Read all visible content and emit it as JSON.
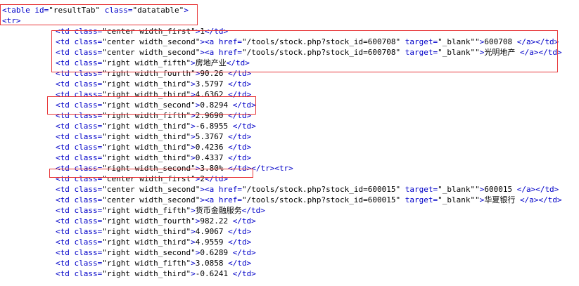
{
  "code_view": {
    "lines": [
      {
        "kind": "open_table",
        "tag": "table",
        "attr1": "id",
        "val1": "\"resultTab\"",
        "attr2": "class",
        "val2": "\"datatable\""
      },
      {
        "kind": "open_tr",
        "tag": "tr"
      },
      {
        "kind": "td",
        "cls": "\"center width_first\"",
        "text": "1"
      },
      {
        "kind": "td_link",
        "cls": "\"center width_second\"",
        "href": "\"/tools/stock.php?stock_id=600708\"",
        "target": "\"_blank\"\"",
        "text": "600708 "
      },
      {
        "kind": "td_link",
        "cls": "\"center width_second\"",
        "href": "\"/tools/stock.php?stock_id=600708\"",
        "target": "\"_blank\"\"",
        "text": "光明地产 "
      },
      {
        "kind": "td",
        "cls": "\"right width_fifth\"",
        "text": "房地产业"
      },
      {
        "kind": "td",
        "cls": "\"right width_fourth\"",
        "text": "90.26 "
      },
      {
        "kind": "td",
        "cls": "\"right width_third\"",
        "text": "3.5797 "
      },
      {
        "kind": "td",
        "cls": "\"right width_third\"",
        "text": "4.6362 "
      },
      {
        "kind": "td",
        "cls": "\"right width_second\"",
        "text": "0.8294 "
      },
      {
        "kind": "td",
        "cls": "\"right width_fifth\"",
        "text": "2.9690 "
      },
      {
        "kind": "td",
        "cls": "\"right width_third\"",
        "text": "-6.8955 "
      },
      {
        "kind": "td",
        "cls": "\"right width_third\"",
        "text": "5.3767 "
      },
      {
        "kind": "td",
        "cls": "\"right width_third\"",
        "text": "0.4236 "
      },
      {
        "kind": "td",
        "cls": "\"right width_third\"",
        "text": "0.4337 "
      },
      {
        "kind": "td_close_row",
        "cls": "\"right width_second\"",
        "text": "3.80% "
      },
      {
        "kind": "td",
        "cls": "\"center width_first\"",
        "text": "2"
      },
      {
        "kind": "td_link",
        "cls": "\"center width_second\"",
        "href": "\"/tools/stock.php?stock_id=600015\"",
        "target": "\"_blank\"\"",
        "text": "600015 "
      },
      {
        "kind": "td_link",
        "cls": "\"center width_second\"",
        "href": "\"/tools/stock.php?stock_id=600015\"",
        "target": "\"_blank\"\"",
        "text": "华夏银行 "
      },
      {
        "kind": "td",
        "cls": "\"right width_fifth\"",
        "text": "货币金融服务"
      },
      {
        "kind": "td",
        "cls": "\"right width_fourth\"",
        "text": "982.22 "
      },
      {
        "kind": "td",
        "cls": "\"right width_third\"",
        "text": "4.9067 "
      },
      {
        "kind": "td",
        "cls": "\"right width_third\"",
        "text": "4.9559 "
      },
      {
        "kind": "td",
        "cls": "\"right width_second\"",
        "text": "0.6289 "
      },
      {
        "kind": "td",
        "cls": "\"right width_fifth\"",
        "text": "3.0858 "
      },
      {
        "kind": "td",
        "cls": "\"right width_third\"",
        "text": "-0.6241 "
      }
    ]
  },
  "colors": {
    "tag": "#0000c8",
    "value": "#000000",
    "highlight_box": "#e8383a"
  }
}
